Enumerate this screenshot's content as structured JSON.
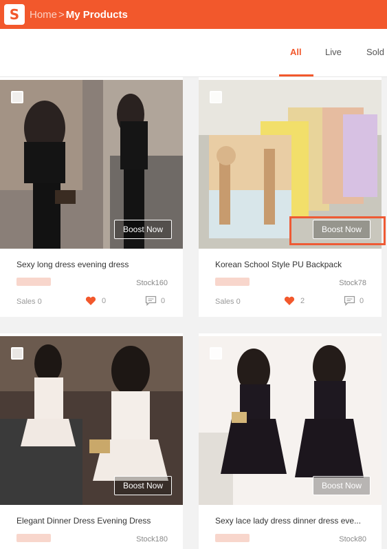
{
  "header": {
    "home": "Home",
    "separator": ">",
    "current": "My Products"
  },
  "tabs": [
    "All",
    "Live",
    "Sold"
  ],
  "products": [
    {
      "name": "Sexy long dress evening dress",
      "stock": "Stock160",
      "sales": "Sales 0",
      "likes": "0",
      "comments": "0",
      "boost": "Boost Now"
    },
    {
      "name": "Korean School Style PU Backpack",
      "stock": "Stock78",
      "sales": "Sales 0",
      "likes": "2",
      "comments": "0",
      "boost": "Boost Now"
    },
    {
      "name": "Elegant Dinner Dress Evening Dress",
      "stock": "Stock180",
      "boost": "Boost Now"
    },
    {
      "name": "Sexy lace lady dress dinner dress eve...",
      "stock": "Stock80",
      "boost": "Boost Now"
    }
  ],
  "colors": {
    "brand": "#f2582c",
    "heart": "#f2582c"
  }
}
